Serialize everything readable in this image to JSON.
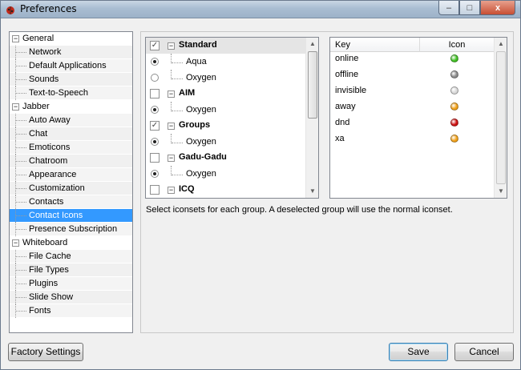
{
  "window": {
    "title": "Preferences",
    "minimize": "–",
    "maximize": "□",
    "close": "x"
  },
  "tree": [
    {
      "label": "General",
      "level": 0
    },
    {
      "label": "Network",
      "level": 1
    },
    {
      "label": "Default Applications",
      "level": 1
    },
    {
      "label": "Sounds",
      "level": 1
    },
    {
      "label": "Text-to-Speech",
      "level": 1
    },
    {
      "label": "Jabber",
      "level": 0
    },
    {
      "label": "Auto Away",
      "level": 1
    },
    {
      "label": "Chat",
      "level": 1
    },
    {
      "label": "Emoticons",
      "level": 1
    },
    {
      "label": "Chatroom",
      "level": 1
    },
    {
      "label": "Appearance",
      "level": 1
    },
    {
      "label": "Customization",
      "level": 1
    },
    {
      "label": "Contacts",
      "level": 1
    },
    {
      "label": "Contact Icons",
      "level": 1,
      "selected": true
    },
    {
      "label": "Presence Subscription",
      "level": 1
    },
    {
      "label": "Whiteboard",
      "level": 0
    },
    {
      "label": "File Cache",
      "level": 1
    },
    {
      "label": "File Types",
      "level": 1
    },
    {
      "label": "Plugins",
      "level": 1
    },
    {
      "label": "Slide Show",
      "level": 1
    },
    {
      "label": "Fonts",
      "level": 1
    }
  ],
  "groups": [
    {
      "type": "group",
      "label": "Standard",
      "checked": true
    },
    {
      "type": "set",
      "label": "Aqua",
      "selected": true
    },
    {
      "type": "set",
      "label": "Oxygen",
      "selected": false
    },
    {
      "type": "group",
      "label": "AIM",
      "checked": false
    },
    {
      "type": "set",
      "label": "Oxygen",
      "selected": true
    },
    {
      "type": "group",
      "label": "Groups",
      "checked": true
    },
    {
      "type": "set",
      "label": "Oxygen",
      "selected": true
    },
    {
      "type": "group",
      "label": "Gadu-Gadu",
      "checked": false
    },
    {
      "type": "set",
      "label": "Oxygen",
      "selected": true
    },
    {
      "type": "group",
      "label": "ICQ",
      "checked": false
    }
  ],
  "icon_table": {
    "headers": {
      "key": "Key",
      "icon": "Icon"
    },
    "rows": [
      {
        "key": "online",
        "color": "#3fbf22"
      },
      {
        "key": "offline",
        "color": "#8a8a8a"
      },
      {
        "key": "invisible",
        "color": "#d8d8d8"
      },
      {
        "key": "away",
        "color": "#f0a018"
      },
      {
        "key": "dnd",
        "color": "#cc1010"
      },
      {
        "key": "xa",
        "color": "#f0a018"
      }
    ]
  },
  "hint": "Select iconsets for each group. A deselected group will use the normal iconset.",
  "buttons": {
    "factory": "Factory Settings",
    "save": "Save",
    "cancel": "Cancel"
  }
}
